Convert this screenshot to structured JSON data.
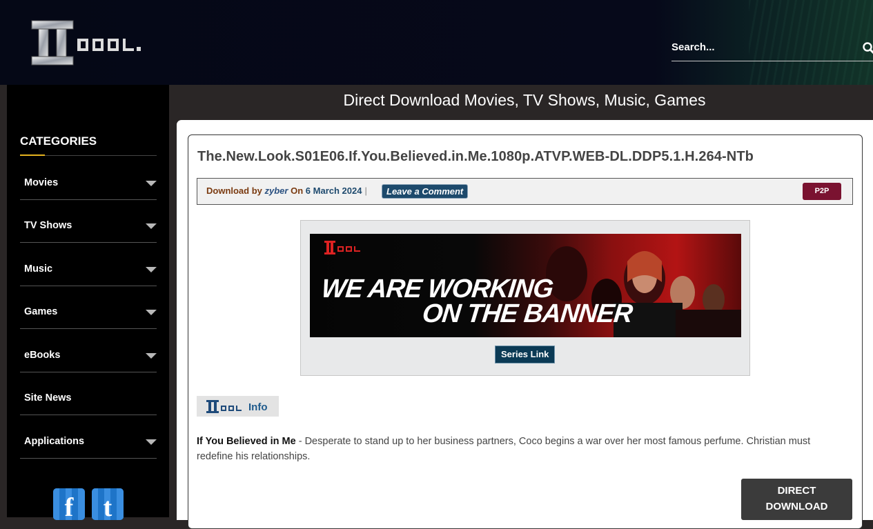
{
  "header": {
    "search_placeholder": "Search..."
  },
  "sidebar": {
    "title": "CATEGORIES",
    "items": [
      {
        "label": "Movies",
        "has_submenu": true
      },
      {
        "label": "TV Shows",
        "has_submenu": true
      },
      {
        "label": "Music",
        "has_submenu": true
      },
      {
        "label": "Games",
        "has_submenu": true
      },
      {
        "label": "eBooks",
        "has_submenu": true
      },
      {
        "label": "Site News",
        "has_submenu": false
      },
      {
        "label": "Applications",
        "has_submenu": true
      }
    ],
    "social": [
      {
        "letter": "f",
        "icon": "facebook-icon"
      },
      {
        "letter": "t",
        "icon": "twitter-icon"
      }
    ]
  },
  "main": {
    "heading": "Direct Download Movies, TV Shows, Music, Games"
  },
  "post": {
    "title": "The.New.Look.S01E06.If.You.Believed.in.Me.1080p.ATVP.WEB-DL.DDP5.1.H.264-NTb",
    "meta": {
      "download_by": "Download by",
      "author": "zyber",
      "on": "On",
      "date": "6 March 2024",
      "separator": "|",
      "comment_label": "Leave a Comment",
      "tag": "P2P"
    },
    "banner": {
      "line1": "WE ARE WORKING",
      "line2": "ON THE BANNER"
    },
    "series_link_label": "Series Link",
    "info_label": "Info",
    "synopsis_title": "If You Believed in Me",
    "synopsis_text": " - Desperate to stand up to her business partners, Coco begins a war over her most famous perfume. Christian must redefine his relationships.",
    "download_line1": "DIRECT",
    "download_line2": "DOWNLOAD"
  },
  "colors": {
    "header_bg": "#050816",
    "sidebar_bg": "#000000",
    "accent_yellow": "#e6b420",
    "p2p_badge": "#7a1230",
    "comment_button": "#1d4a6c",
    "download_button": "#3b3b3b"
  }
}
